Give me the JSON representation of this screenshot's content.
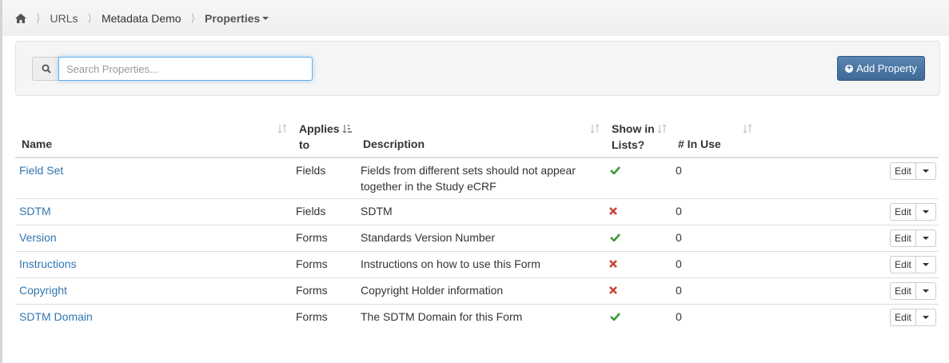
{
  "breadcrumb": {
    "home_icon": "home-icon",
    "items": [
      "URLs",
      "Metadata Demo"
    ],
    "current": "Properties"
  },
  "search": {
    "placeholder": "Search Properties...",
    "value": "",
    "icon": "search-icon"
  },
  "add_button": {
    "label": "Add Property",
    "icon": "plus-circle-icon"
  },
  "table": {
    "headers": {
      "name": "Name",
      "applies_to_1": "Applies",
      "applies_to_2": "to",
      "description": "Description",
      "show_in_lists_1": "Show in",
      "show_in_lists_2": "Lists?",
      "in_use": "# In Use"
    },
    "rows": [
      {
        "name": "Field Set",
        "applies_to": "Fields",
        "description": "Fields from different sets should not appear together in the Study eCRF",
        "show_in_lists": true,
        "in_use": "0",
        "edit_label": "Edit"
      },
      {
        "name": "SDTM",
        "applies_to": "Fields",
        "description": "SDTM",
        "show_in_lists": false,
        "in_use": "0",
        "edit_label": "Edit"
      },
      {
        "name": "Version",
        "applies_to": "Forms",
        "description": "Standards Version Number",
        "show_in_lists": true,
        "in_use": "0",
        "edit_label": "Edit"
      },
      {
        "name": "Instructions",
        "applies_to": "Forms",
        "description": "Instructions on how to use this Form",
        "show_in_lists": false,
        "in_use": "0",
        "edit_label": "Edit"
      },
      {
        "name": "Copyright",
        "applies_to": "Forms",
        "description": "Copyright Holder information",
        "show_in_lists": false,
        "in_use": "0",
        "edit_label": "Edit"
      },
      {
        "name": "SDTM Domain",
        "applies_to": "Forms",
        "description": "The SDTM Domain for this Form",
        "show_in_lists": true,
        "in_use": "0",
        "edit_label": "Edit"
      }
    ]
  },
  "colors": {
    "link": "#3276b1",
    "check": "#3c9a36",
    "cross": "#c9423a",
    "primary_button": "#4a76a4"
  }
}
